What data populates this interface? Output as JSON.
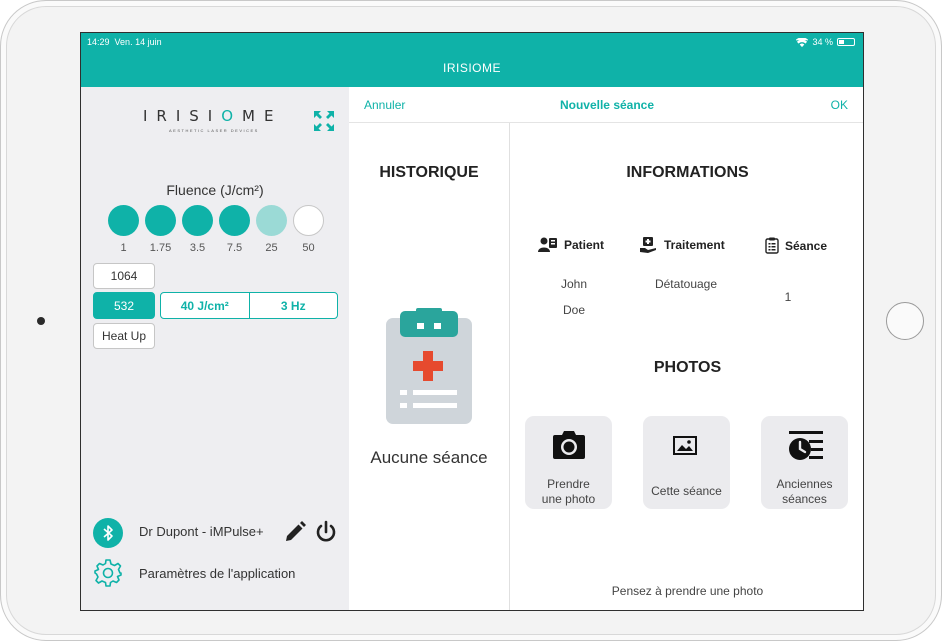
{
  "status": {
    "time": "14:29",
    "date": "Ven. 14 juin",
    "battery": "34 %"
  },
  "app": {
    "title": "IRISIOME"
  },
  "sidebar": {
    "logo": "IRISIOME",
    "logo_tagline": "AESTHETIC LASER DEVICES",
    "fluence_title": "Fluence (J/cm²)",
    "fluence_levels": [
      "1",
      "1.75",
      "3.5",
      "7.5",
      "25",
      "50"
    ],
    "selected_fluence_index": 4,
    "wavelengths": [
      "1064",
      "532"
    ],
    "selected_wavelength": "532",
    "fluence_value": "40 J/cm²",
    "frequency_value": "3 Hz",
    "heat_up_label": "Heat Up",
    "user_label": "Dr Dupont - iMPulse+",
    "settings_label": "Paramètres de l'application"
  },
  "nav": {
    "cancel": "Annuler",
    "title": "Nouvelle séance",
    "ok": "OK"
  },
  "history": {
    "title": "HISTORIQUE",
    "empty_text": "Aucune séance"
  },
  "info": {
    "title": "INFORMATIONS",
    "patient_header": "Patient",
    "treatment_header": "Traitement",
    "session_header": "Séance",
    "patient_first": "John",
    "patient_last": "Doe",
    "treatment": "Détatouage",
    "session_number": "1",
    "plus": "+",
    "minus": "−"
  },
  "photos": {
    "title": "PHOTOS",
    "take_photo_line1": "Prendre",
    "take_photo_line2": "une photo",
    "this_session": "Cette séance",
    "old_sessions_line1": "Anciennes",
    "old_sessions_line2": "séances",
    "hint": "Pensez à prendre une photo"
  },
  "colors": {
    "accent": "#0fb2a8",
    "accent_light": "#9bdad6",
    "red_cross": "#e64a2e"
  }
}
